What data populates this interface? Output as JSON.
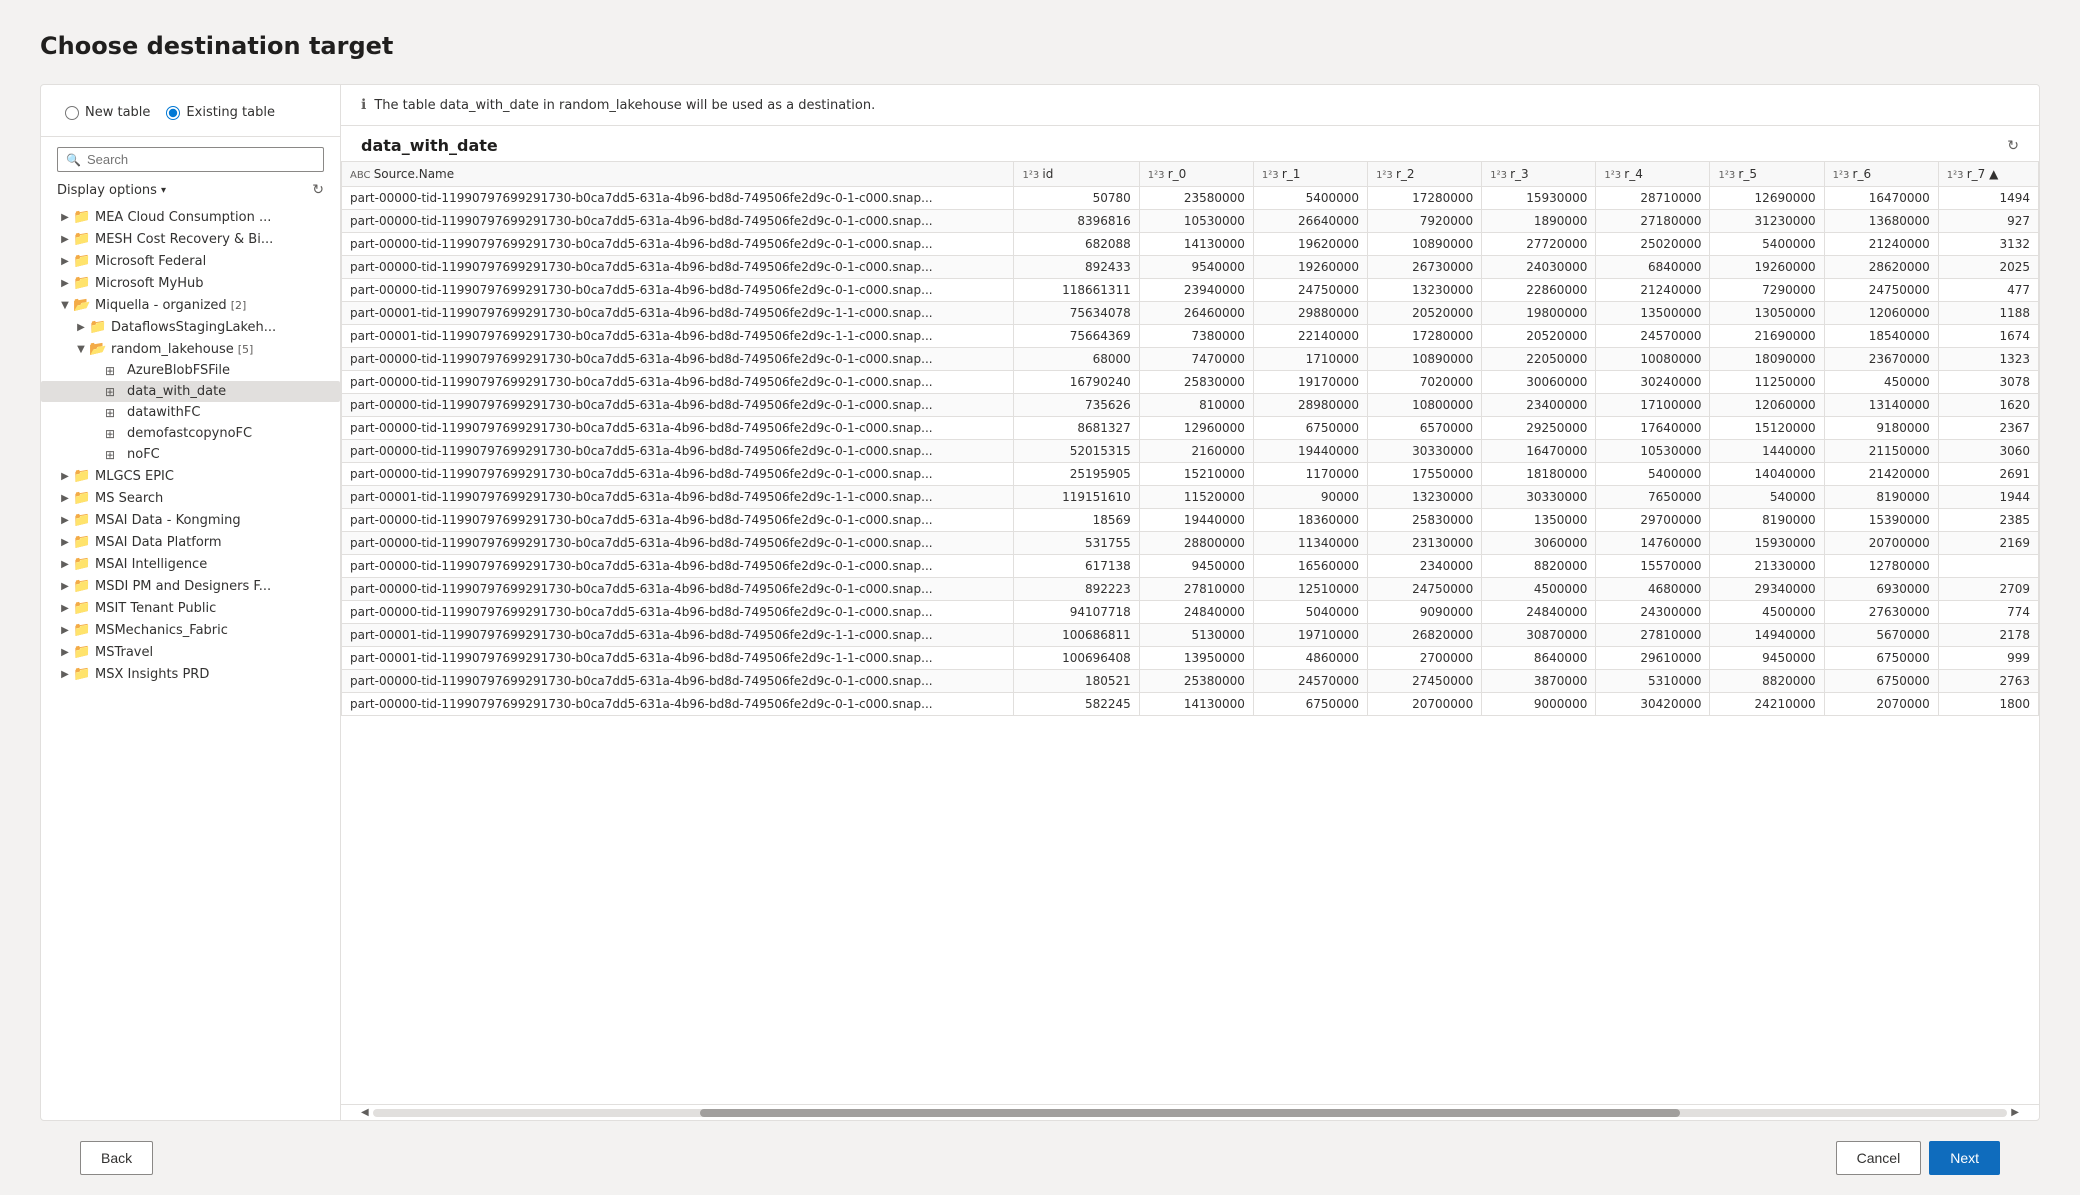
{
  "page": {
    "title": "Choose destination target"
  },
  "left_panel": {
    "radio_options": [
      {
        "id": "new-table",
        "label": "New table",
        "checked": false
      },
      {
        "id": "existing-table",
        "label": "Existing table",
        "checked": true
      }
    ],
    "search_placeholder": "Search",
    "display_options_label": "Display options",
    "tree_items": [
      {
        "level": 1,
        "type": "folder",
        "label": "MEA Cloud Consumption ...",
        "expanded": false,
        "badge": ""
      },
      {
        "level": 1,
        "type": "folder",
        "label": "MESH Cost Recovery & Bi...",
        "expanded": false,
        "badge": ""
      },
      {
        "level": 1,
        "type": "folder",
        "label": "Microsoft Federal",
        "expanded": false,
        "badge": ""
      },
      {
        "level": 1,
        "type": "folder",
        "label": "Microsoft MyHub",
        "expanded": false,
        "badge": ""
      },
      {
        "level": 1,
        "type": "folder",
        "label": "Miquella - organized",
        "expanded": true,
        "badge": "[2]"
      },
      {
        "level": 2,
        "type": "folder",
        "label": "DataflowsStagingLakeh...",
        "expanded": false,
        "badge": ""
      },
      {
        "level": 2,
        "type": "folder",
        "label": "random_lakehouse",
        "expanded": true,
        "badge": "[5]"
      },
      {
        "level": 3,
        "type": "table",
        "label": "AzureBlobFSFile",
        "expanded": false,
        "badge": "",
        "selected": false
      },
      {
        "level": 3,
        "type": "table",
        "label": "data_with_date",
        "expanded": false,
        "badge": "",
        "selected": true
      },
      {
        "level": 3,
        "type": "table",
        "label": "datawithFC",
        "expanded": false,
        "badge": "",
        "selected": false
      },
      {
        "level": 3,
        "type": "table",
        "label": "demofastcopynoFC",
        "expanded": false,
        "badge": "",
        "selected": false
      },
      {
        "level": 3,
        "type": "table",
        "label": "noFC",
        "expanded": false,
        "badge": "",
        "selected": false
      },
      {
        "level": 1,
        "type": "folder",
        "label": "MLGCS EPIC",
        "expanded": false,
        "badge": ""
      },
      {
        "level": 1,
        "type": "folder",
        "label": "MS Search",
        "expanded": false,
        "badge": ""
      },
      {
        "level": 1,
        "type": "folder",
        "label": "MSAI Data - Kongming",
        "expanded": false,
        "badge": ""
      },
      {
        "level": 1,
        "type": "folder",
        "label": "MSAI Data Platform",
        "expanded": false,
        "badge": ""
      },
      {
        "level": 1,
        "type": "folder",
        "label": "MSAI Intelligence",
        "expanded": false,
        "badge": ""
      },
      {
        "level": 1,
        "type": "folder",
        "label": "MSDI PM and Designers F...",
        "expanded": false,
        "badge": ""
      },
      {
        "level": 1,
        "type": "folder",
        "label": "MSIT Tenant Public",
        "expanded": false,
        "badge": ""
      },
      {
        "level": 1,
        "type": "folder",
        "label": "MSMechanics_Fabric",
        "expanded": false,
        "badge": ""
      },
      {
        "level": 1,
        "type": "folder",
        "label": "MSTravel",
        "expanded": false,
        "badge": ""
      },
      {
        "level": 1,
        "type": "folder",
        "label": "MSX Insights PRD",
        "expanded": false,
        "badge": ""
      }
    ]
  },
  "right_panel": {
    "info_message": "The table data_with_date in random_lakehouse will be used as a destination.",
    "table_name": "data_with_date",
    "columns": [
      {
        "name": "Source.Name",
        "type": "ABC"
      },
      {
        "name": "id",
        "type": "1²3"
      },
      {
        "name": "r_0",
        "type": "1²3"
      },
      {
        "name": "r_1",
        "type": "1²3"
      },
      {
        "name": "r_2",
        "type": "1²3"
      },
      {
        "name": "r_3",
        "type": "1²3"
      },
      {
        "name": "r_4",
        "type": "1²3"
      },
      {
        "name": "r_5",
        "type": "1²3"
      },
      {
        "name": "r_6",
        "type": "1²3"
      },
      {
        "name": "r_7",
        "type": "1²3"
      }
    ],
    "rows": [
      [
        "part-00000-tid-11990797699291730-b0ca7dd5-631a-4b96-bd8d-749506fe2d9c-0-1-c000.snap...",
        "50780",
        "23580000",
        "5400000",
        "17280000",
        "15930000",
        "28710000",
        "12690000",
        "16470000",
        "1494"
      ],
      [
        "part-00000-tid-11990797699291730-b0ca7dd5-631a-4b96-bd8d-749506fe2d9c-0-1-c000.snap...",
        "8396816",
        "10530000",
        "26640000",
        "7920000",
        "1890000",
        "27180000",
        "31230000",
        "13680000",
        "927"
      ],
      [
        "part-00000-tid-11990797699291730-b0ca7dd5-631a-4b96-bd8d-749506fe2d9c-0-1-c000.snap...",
        "682088",
        "14130000",
        "19620000",
        "10890000",
        "27720000",
        "25020000",
        "5400000",
        "21240000",
        "3132"
      ],
      [
        "part-00000-tid-11990797699291730-b0ca7dd5-631a-4b96-bd8d-749506fe2d9c-0-1-c000.snap...",
        "892433",
        "9540000",
        "19260000",
        "26730000",
        "24030000",
        "6840000",
        "19260000",
        "28620000",
        "2025"
      ],
      [
        "part-00000-tid-11990797699291730-b0ca7dd5-631a-4b96-bd8d-749506fe2d9c-0-1-c000.snap...",
        "118661311",
        "23940000",
        "24750000",
        "13230000",
        "22860000",
        "21240000",
        "7290000",
        "24750000",
        "477"
      ],
      [
        "part-00001-tid-11990797699291730-b0ca7dd5-631a-4b96-bd8d-749506fe2d9c-1-1-c000.snap...",
        "75634078",
        "26460000",
        "29880000",
        "20520000",
        "19800000",
        "13500000",
        "13050000",
        "12060000",
        "1188"
      ],
      [
        "part-00001-tid-11990797699291730-b0ca7dd5-631a-4b96-bd8d-749506fe2d9c-1-1-c000.snap...",
        "75664369",
        "7380000",
        "22140000",
        "17280000",
        "20520000",
        "24570000",
        "21690000",
        "18540000",
        "1674"
      ],
      [
        "part-00000-tid-11990797699291730-b0ca7dd5-631a-4b96-bd8d-749506fe2d9c-0-1-c000.snap...",
        "68000",
        "7470000",
        "1710000",
        "10890000",
        "22050000",
        "10080000",
        "18090000",
        "23670000",
        "1323"
      ],
      [
        "part-00000-tid-11990797699291730-b0ca7dd5-631a-4b96-bd8d-749506fe2d9c-0-1-c000.snap...",
        "16790240",
        "25830000",
        "19170000",
        "7020000",
        "30060000",
        "30240000",
        "11250000",
        "450000",
        "3078"
      ],
      [
        "part-00000-tid-11990797699291730-b0ca7dd5-631a-4b96-bd8d-749506fe2d9c-0-1-c000.snap...",
        "735626",
        "810000",
        "28980000",
        "10800000",
        "23400000",
        "17100000",
        "12060000",
        "13140000",
        "1620"
      ],
      [
        "part-00000-tid-11990797699291730-b0ca7dd5-631a-4b96-bd8d-749506fe2d9c-0-1-c000.snap...",
        "8681327",
        "12960000",
        "6750000",
        "6570000",
        "29250000",
        "17640000",
        "15120000",
        "9180000",
        "2367"
      ],
      [
        "part-00000-tid-11990797699291730-b0ca7dd5-631a-4b96-bd8d-749506fe2d9c-0-1-c000.snap...",
        "52015315",
        "2160000",
        "19440000",
        "30330000",
        "16470000",
        "10530000",
        "1440000",
        "21150000",
        "3060"
      ],
      [
        "part-00000-tid-11990797699291730-b0ca7dd5-631a-4b96-bd8d-749506fe2d9c-0-1-c000.snap...",
        "25195905",
        "15210000",
        "1170000",
        "17550000",
        "18180000",
        "5400000",
        "14040000",
        "21420000",
        "2691"
      ],
      [
        "part-00001-tid-11990797699291730-b0ca7dd5-631a-4b96-bd8d-749506fe2d9c-1-1-c000.snap...",
        "119151610",
        "11520000",
        "90000",
        "13230000",
        "30330000",
        "7650000",
        "540000",
        "8190000",
        "1944"
      ],
      [
        "part-00000-tid-11990797699291730-b0ca7dd5-631a-4b96-bd8d-749506fe2d9c-0-1-c000.snap...",
        "18569",
        "19440000",
        "18360000",
        "25830000",
        "1350000",
        "29700000",
        "8190000",
        "15390000",
        "2385"
      ],
      [
        "part-00000-tid-11990797699291730-b0ca7dd5-631a-4b96-bd8d-749506fe2d9c-0-1-c000.snap...",
        "531755",
        "28800000",
        "11340000",
        "23130000",
        "3060000",
        "14760000",
        "15930000",
        "20700000",
        "2169"
      ],
      [
        "part-00000-tid-11990797699291730-b0ca7dd5-631a-4b96-bd8d-749506fe2d9c-0-1-c000.snap...",
        "617138",
        "9450000",
        "16560000",
        "2340000",
        "8820000",
        "15570000",
        "21330000",
        "12780000",
        ""
      ],
      [
        "part-00000-tid-11990797699291730-b0ca7dd5-631a-4b96-bd8d-749506fe2d9c-0-1-c000.snap...",
        "892223",
        "27810000",
        "12510000",
        "24750000",
        "4500000",
        "4680000",
        "29340000",
        "6930000",
        "2709"
      ],
      [
        "part-00000-tid-11990797699291730-b0ca7dd5-631a-4b96-bd8d-749506fe2d9c-0-1-c000.snap...",
        "94107718",
        "24840000",
        "5040000",
        "9090000",
        "24840000",
        "24300000",
        "4500000",
        "27630000",
        "774"
      ],
      [
        "part-00001-tid-11990797699291730-b0ca7dd5-631a-4b96-bd8d-749506fe2d9c-1-1-c000.snap...",
        "100686811",
        "5130000",
        "19710000",
        "26820000",
        "30870000",
        "27810000",
        "14940000",
        "5670000",
        "2178"
      ],
      [
        "part-00001-tid-11990797699291730-b0ca7dd5-631a-4b96-bd8d-749506fe2d9c-1-1-c000.snap...",
        "100696408",
        "13950000",
        "4860000",
        "2700000",
        "8640000",
        "29610000",
        "9450000",
        "6750000",
        "999"
      ],
      [
        "part-00000-tid-11990797699291730-b0ca7dd5-631a-4b96-bd8d-749506fe2d9c-0-1-c000.snap...",
        "180521",
        "25380000",
        "24570000",
        "27450000",
        "3870000",
        "5310000",
        "8820000",
        "6750000",
        "2763"
      ],
      [
        "part-00000-tid-11990797699291730-b0ca7dd5-631a-4b96-bd8d-749506fe2d9c-0-1-c000.snap...",
        "582245",
        "14130000",
        "6750000",
        "20700000",
        "9000000",
        "30420000",
        "24210000",
        "2070000",
        "1800"
      ]
    ]
  },
  "footer": {
    "back_label": "Back",
    "cancel_label": "Cancel",
    "next_label": "Next"
  }
}
